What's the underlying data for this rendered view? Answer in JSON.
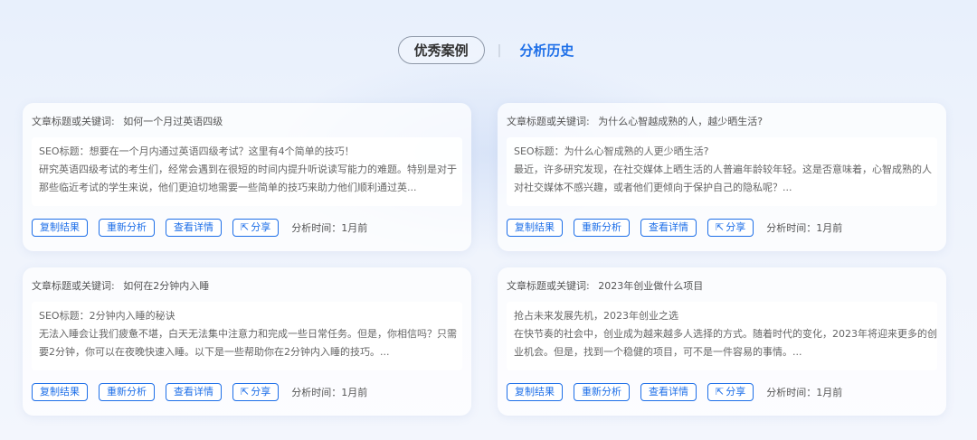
{
  "tabs": [
    {
      "label": "优秀案例"
    },
    {
      "label": "分析历史"
    }
  ],
  "separator": "|",
  "cards": [
    {
      "keyword_label": "文章标题或关键词:",
      "keyword": "如何一个月过英语四级",
      "seo_title": "SEO标题：想要在一个月内通过英语四级考试？这里有4个简单的技巧！",
      "desc": "研究英语四级考试的考生们，经常会遇到在很短的时间内提升听说读写能力的难题。特别是对于那些临近考试的学生来说，他们更迫切地需要一些简单的技巧来助力他们顺利通过英...",
      "copy": "复制结果",
      "reanalyze": "重新分析",
      "detail": "查看详情",
      "share": "分享",
      "time": "分析时间：1月前"
    },
    {
      "keyword_label": "文章标题或关键词:",
      "keyword": "为什么心智越成熟的人，越少晒生活?",
      "seo_title": "SEO标题：为什么心智成熟的人更少晒生活?",
      "desc": "最近，许多研究发现，在社交媒体上晒生活的人普遍年龄较年轻。这是否意味着，心智成熟的人对社交媒体不感兴趣，或者他们更倾向于保护自己的隐私呢？...",
      "copy": "复制结果",
      "reanalyze": "重新分析",
      "detail": "查看详情",
      "share": "分享",
      "time": "分析时间：1月前"
    },
    {
      "keyword_label": "文章标题或关键词:",
      "keyword": "如何在2分钟内入睡",
      "seo_title": "SEO标题：2分钟内入睡的秘诀",
      "desc": "无法入睡会让我们疲惫不堪，白天无法集中注意力和完成一些日常任务。但是，你相信吗？只需要2分钟，你可以在夜晚快速入睡。以下是一些帮助你在2分钟内入睡的技巧。...",
      "copy": "复制结果",
      "reanalyze": "重新分析",
      "detail": "查看详情",
      "share": "分享",
      "time": "分析时间：1月前"
    },
    {
      "keyword_label": "文章标题或关键词:",
      "keyword": "2023年创业做什么项目",
      "seo_title": "抢占未来发展先机，2023年创业之选",
      "desc": "在快节奏的社会中，创业成为越来越多人选择的方式。随着时代的变化，2023年将迎来更多的创业机会。但是，找到一个稳健的项目，可不是一件容易的事情。...",
      "copy": "复制结果",
      "reanalyze": "重新分析",
      "detail": "查看详情",
      "share": "分享",
      "time": "分析时间：1月前"
    }
  ],
  "icons": {
    "share": "share-icon"
  },
  "colors": {
    "accent": "#1e6fe8",
    "background": "#eef3fc"
  }
}
